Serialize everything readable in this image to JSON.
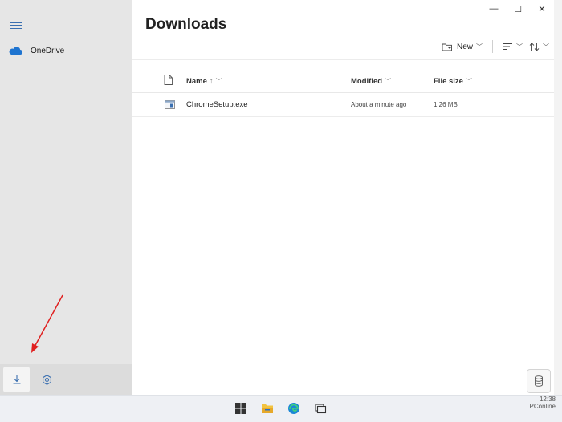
{
  "window": {
    "controls": {
      "minimize": "—",
      "maximize": "☐",
      "close": "✕"
    }
  },
  "sidebar": {
    "items": [
      {
        "label": "OneDrive",
        "icon": "onedrive-cloud-icon"
      }
    ],
    "bottom": [
      {
        "icon": "download-icon",
        "selected": true
      },
      {
        "icon": "gear-icon",
        "selected": false
      }
    ]
  },
  "main": {
    "title": "Downloads",
    "toolbar": {
      "new_label": "New"
    },
    "columns": {
      "name": "Name",
      "modified": "Modified",
      "size": "File size"
    },
    "files": [
      {
        "name": "ChromeSetup.exe",
        "modified": "About a minute ago",
        "size": "1.26 MB"
      }
    ]
  },
  "taskbar": {
    "apps": [
      "windows-start-icon",
      "file-explorer-icon",
      "edge-icon",
      "task-view-icon"
    ],
    "clock": {
      "time": "12:38",
      "date": "PConline"
    }
  },
  "colors": {
    "accent": "#3a6fb0",
    "onedrive": "#1e74d0",
    "annotation": "#e02020"
  }
}
